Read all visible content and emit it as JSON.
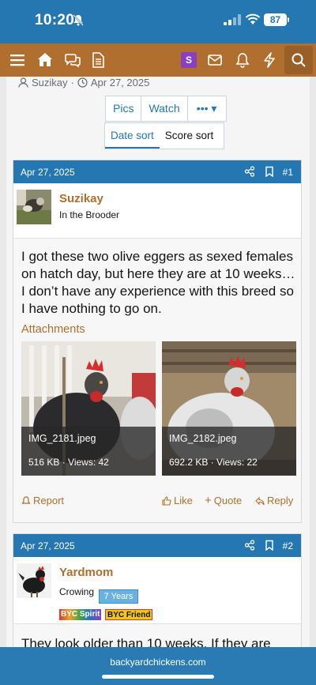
{
  "status_bar": {
    "time": "10:20",
    "battery": "87"
  },
  "nav": {
    "notification_badge": "S"
  },
  "thread_meta": {
    "author": "Suzikay",
    "date": "Apr 27, 2025"
  },
  "toolbar": {
    "pics": "Pics",
    "watch": "Watch",
    "more": "••• ▾"
  },
  "sort": {
    "date": "Date sort",
    "score": "Score sort"
  },
  "posts": [
    {
      "date": "Apr 27, 2025",
      "number": "#1",
      "username": "Suzikay",
      "user_title": "In the Brooder",
      "message": "I got these two olive eggers as sexed females on hatch day, but here they are at 10 weeks… I don’t have any experience with this breed so I have nothing to go on.",
      "attachments_label": "Attachments",
      "attachments": [
        {
          "filename": "IMG_2181.jpeg",
          "info": "516 KB · Views: 42"
        },
        {
          "filename": "IMG_2182.jpeg",
          "info": "692.2 KB · Views: 22"
        }
      ],
      "actions": {
        "report": "Report",
        "like": "Like",
        "quote": "Quote",
        "reply": "Reply"
      }
    },
    {
      "date": "Apr 27, 2025",
      "number": "#2",
      "username": "Yardmom",
      "user_title": "Crowing",
      "years_badge": "7 Years",
      "spirit_badge": "BYC Spirit",
      "friend_badge": "BYC Friend",
      "message": "They look older than 10 weeks. If they are"
    }
  ],
  "browser": {
    "url": "backyardchickens.com"
  },
  "colors": {
    "brand_blue": "#2577b1",
    "brand_brown": "#b06f2e"
  }
}
